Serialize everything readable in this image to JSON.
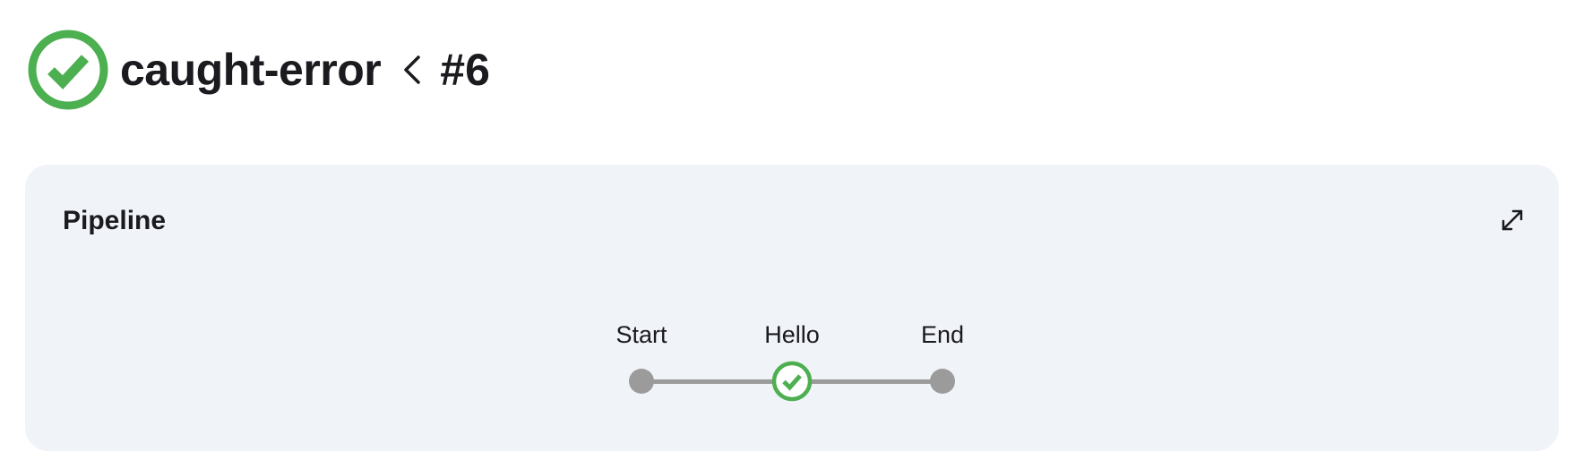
{
  "header": {
    "job_name": "caught-error",
    "build_number": "#6",
    "status_icon": "success-check-circle-icon",
    "separator_icon": "chevron-left-icon"
  },
  "pipeline_panel": {
    "title": "Pipeline",
    "expand_icon": "expand-arrows-icon",
    "stages": [
      {
        "label": "Start",
        "type": "start"
      },
      {
        "label": "Hello",
        "type": "stage",
        "status": "success"
      },
      {
        "label": "End",
        "type": "end"
      }
    ]
  },
  "colors": {
    "success": "#4caf50",
    "node_gray": "#9b9b9b",
    "panel_bg": "#f0f3f7",
    "text": "#1a1a1f"
  }
}
